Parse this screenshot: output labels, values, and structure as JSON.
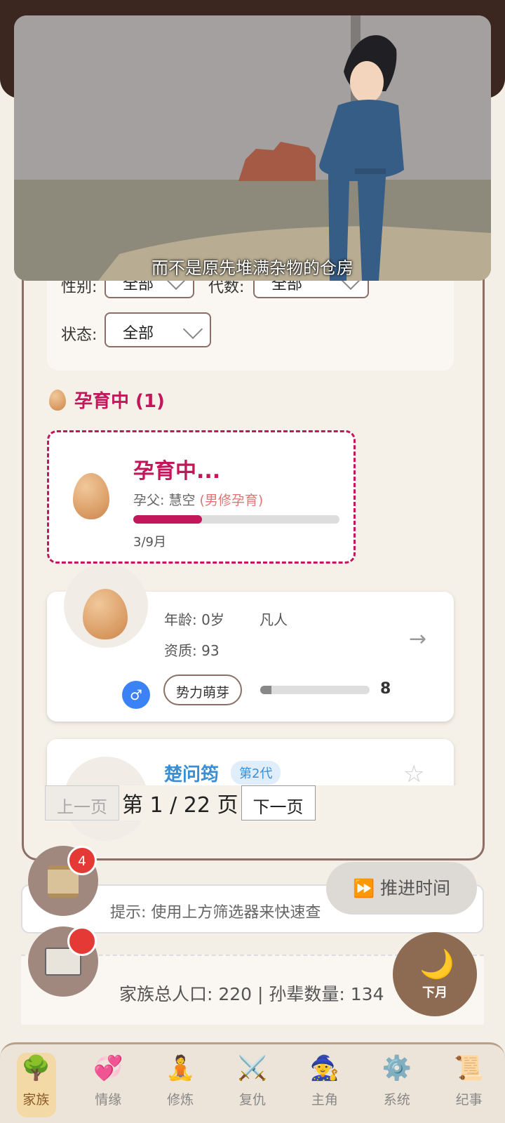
{
  "filters": {
    "gender_label": "性别:",
    "gender_value": "全部",
    "generation_label": "代数:",
    "generation_value": "全部",
    "status_label": "状态:",
    "status_value": "全部"
  },
  "pregnancy_section": {
    "title": "孕育中 (1)",
    "card": {
      "title": "孕育中...",
      "father_label": "孕父: 慧空",
      "father_tag": "(男修孕育)",
      "progress_fraction": 0.3333,
      "month_text": "3/9月"
    }
  },
  "character_card_1": {
    "age_text": "年龄: 0岁",
    "realm_text": "凡人",
    "aptitude_text": "资质: 93",
    "gender_symbol": "♂",
    "power_label": "势力萌芽",
    "power_value": "8",
    "power_fraction": 0.1,
    "arrow": "→",
    "star": "☆"
  },
  "character_card_2": {
    "name": "楚问筠",
    "generation_badge": "第2代",
    "star": "☆"
  },
  "pagination": {
    "prev_label": "上一页",
    "page_text": "第 1 / 22 页",
    "next_label": "下一页"
  },
  "hint": {
    "text": "提示: 使用上方筛选器来快速查"
  },
  "stats": {
    "text": "家族总人口: 220 | 孙辈数量: 134"
  },
  "badges": {
    "scroll_count": "4"
  },
  "actions": {
    "advance_time": "⏩ 推进时间",
    "next_month_icon": "🌙",
    "next_month_label": "下月"
  },
  "nav": [
    {
      "label": "家族",
      "icon": "🌳",
      "active": true
    },
    {
      "label": "情缘",
      "icon": "💞",
      "active": false
    },
    {
      "label": "修炼",
      "icon": "🧘",
      "active": false
    },
    {
      "label": "复仇",
      "icon": "⚔️",
      "active": false
    },
    {
      "label": "主角",
      "icon": "🧙",
      "active": false
    },
    {
      "label": "系统",
      "icon": "⚙️",
      "active": false
    },
    {
      "label": "纪事",
      "icon": "📜",
      "active": false
    }
  ],
  "video": {
    "subtitle": "而不是原先堆满杂物的仓房"
  },
  "colors": {
    "accent": "#c2185b",
    "brand_brown": "#8b6f66",
    "link_blue": "#3a8ed4"
  }
}
